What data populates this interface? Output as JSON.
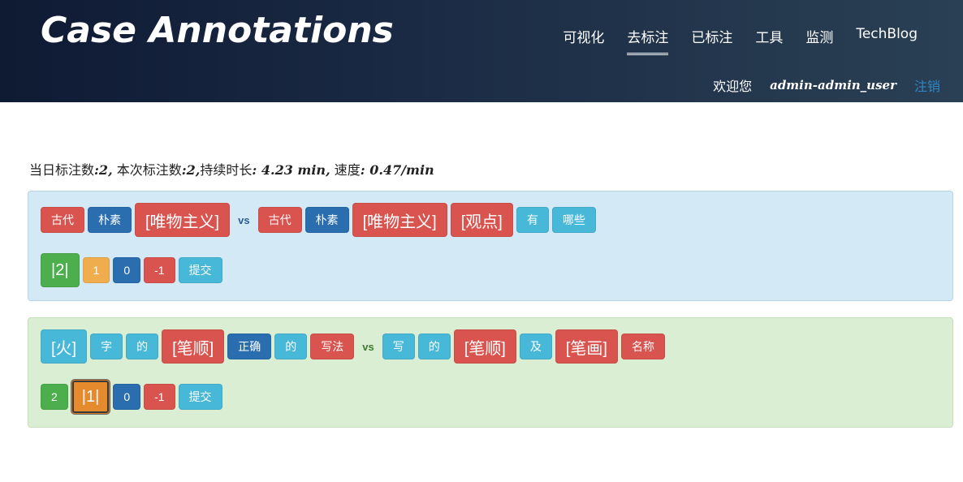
{
  "header": {
    "brand": "Case Annotations",
    "nav": [
      "可视化",
      "去标注",
      "已标注",
      "工具",
      "监测",
      "TechBlog"
    ],
    "welcome": "欢迎您",
    "username": "admin-admin_user",
    "logout": "注销"
  },
  "stats": {
    "daily_label": "当日标注数",
    "daily_value": "2",
    "session_label": "本次标注数",
    "session_value": "2",
    "duration_label": "持续时长",
    "duration_value": "4.23 min",
    "speed_label": "速度",
    "speed_value": "0.47/min"
  },
  "cases": [
    {
      "left_tokens": [
        "古代",
        "朴素",
        "[唯物主义]"
      ],
      "vs": "vs",
      "right_tokens": [
        "古代",
        "朴素",
        "[唯物主义]",
        "[观点]",
        "有",
        "哪些"
      ],
      "options": [
        "|2|",
        "1",
        "0",
        "-1",
        "提交"
      ]
    },
    {
      "left_tokens": [
        "[火]",
        "字",
        "的",
        "[笔顺]",
        "正确",
        "的",
        "写法"
      ],
      "vs": "vs",
      "right_tokens": [
        "写",
        "的",
        "[笔顺]",
        "及",
        "[笔画]",
        "名称"
      ],
      "options": [
        "2",
        "|1|",
        "0",
        "-1",
        "提交"
      ]
    }
  ],
  "colors": {
    "red": "#d9534f",
    "blue": "#2a6eb0",
    "cyan": "#48b8d8",
    "green": "#4cae4c",
    "orange": "#f0ad4e",
    "card_blue": "#d4e9f6",
    "card_green": "#daeed3"
  }
}
